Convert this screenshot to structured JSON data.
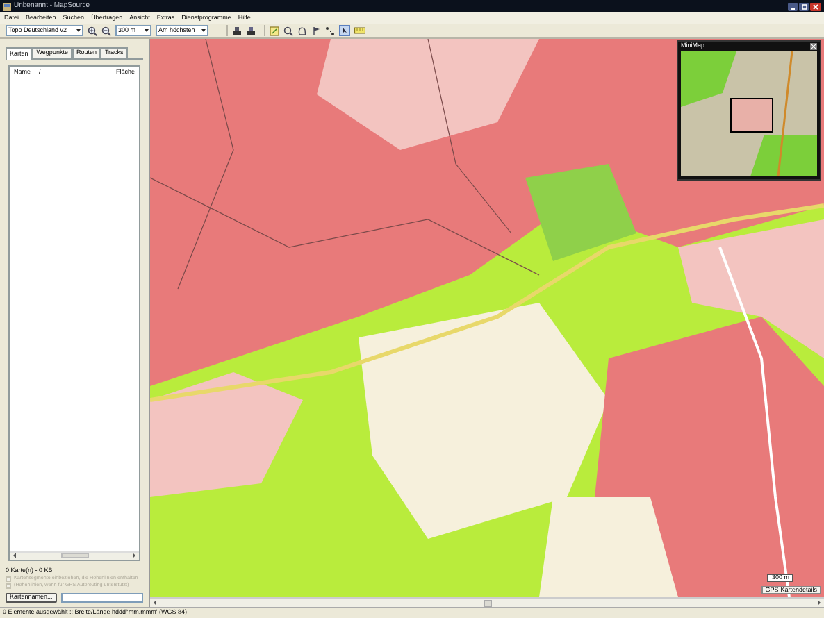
{
  "window": {
    "title": "Unbenannt - MapSource"
  },
  "menu": [
    "Datei",
    "Bearbeiten",
    "Suchen",
    "Übertragen",
    "Ansicht",
    "Extras",
    "Dienstprogramme",
    "Hilfe"
  ],
  "toolbar": {
    "map_product": "Topo Deutschland v2",
    "zoom": "300 m",
    "detail": "Am höchsten"
  },
  "tabs": [
    {
      "label": "Karten",
      "selected": true
    },
    {
      "label": "Wegpunkte",
      "selected": false
    },
    {
      "label": "Routen",
      "selected": false
    },
    {
      "label": "Tracks",
      "selected": false
    }
  ],
  "list": {
    "columns": [
      "Name",
      "Fläche"
    ],
    "sort_indicator": "/"
  },
  "summary": "0 Karte(n) - 0 KB",
  "options": [
    {
      "label": "Kartensegmente einbeziehen, die Höhenlinien enthalten",
      "checked": false,
      "disabled": true
    },
    {
      "label": "(Höhenlinien, wenn für GPS Autorouting unterstützt)",
      "checked": false,
      "disabled": true
    }
  ],
  "map_name_button": "Kartennamen...",
  "map": {
    "minimap": {
      "title": "MiniMap"
    },
    "scale": "300 m",
    "details_button": "GPS-Kartendetails"
  },
  "status_bar": "0 Elemente ausgewählt :: Breite/Länge hddd°mm.mmm' (WGS 84)"
}
